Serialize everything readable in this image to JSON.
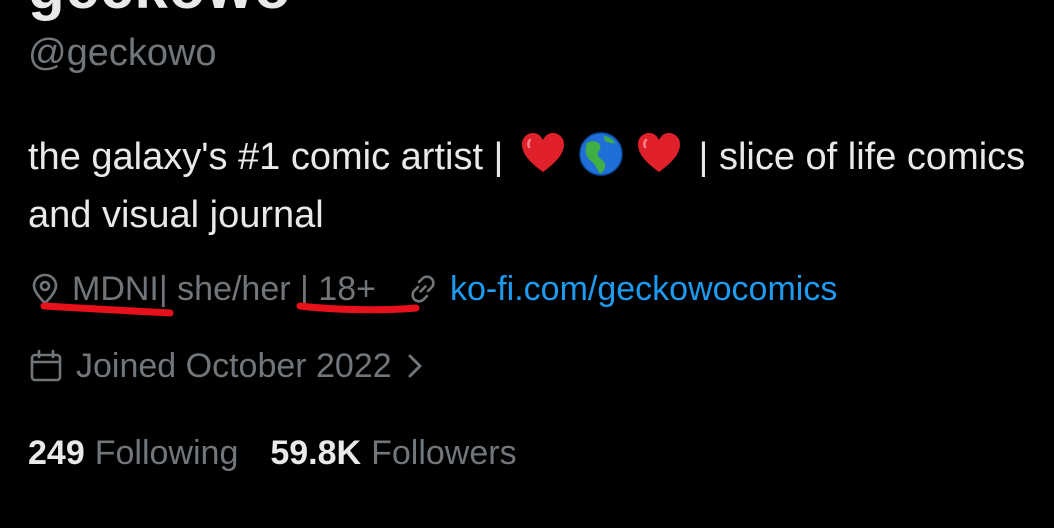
{
  "profile": {
    "display_name": "geckowo",
    "handle": "@geckowo",
    "bio": {
      "line1_start": "the galaxy's #1 comic artist | ",
      "line1_emojis": [
        "red-heart-emoji",
        "globe-americas-emoji",
        "red-heart-emoji"
      ],
      "line1_end": " | slice of life comics",
      "line2": "and visual journal"
    },
    "location": "MDNI",
    "location_rest": " | she/her | 18+",
    "website": "ko-fi.com/geckowocomics",
    "joined": "Joined October 2022",
    "following_count": "249",
    "following_label": "Following",
    "followers_count": "59.8K",
    "followers_label": "Followers"
  },
  "icons": {
    "location": "location-pin-icon",
    "link": "link-icon",
    "calendar": "calendar-icon",
    "chevron": "chevron-right-icon"
  },
  "colors": {
    "background": "#000000",
    "primary_text": "#e7e9ea",
    "secondary_text": "#71767b",
    "link": "#1d9bf0",
    "annotation": "#e8101a"
  }
}
